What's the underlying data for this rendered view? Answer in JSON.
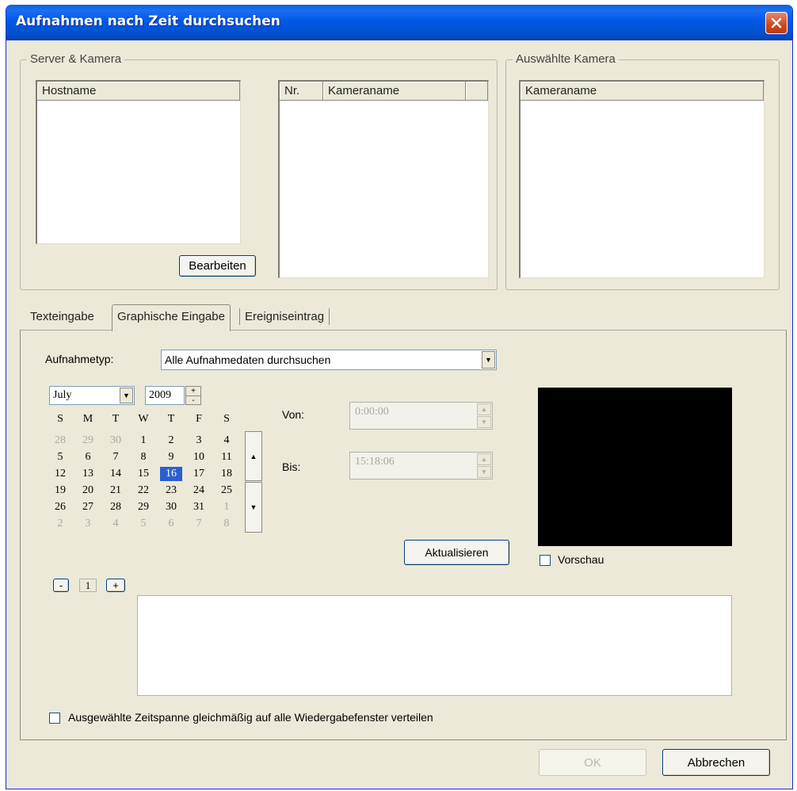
{
  "window": {
    "title": "Aufnahmen nach Zeit durchsuchen"
  },
  "server_group": {
    "label": "Server & Kamera",
    "host_header": "Hostname",
    "cam_headers": [
      "Nr.",
      "Kameraname"
    ],
    "edit_button": "Bearbeiten"
  },
  "selected_group": {
    "label": "Auswählte Kamera",
    "header": "Kameraname"
  },
  "tabs": [
    {
      "label": "Texteingabe",
      "active": false
    },
    {
      "label": "Graphische Eingabe",
      "active": true
    },
    {
      "label": "Ereigniseintrag",
      "active": false
    }
  ],
  "recording_type": {
    "label": "Aufnahmetyp:",
    "value": "Alle Aufnahmedaten durchsuchen"
  },
  "calendar": {
    "month": "July",
    "year": "2009",
    "weekdays": [
      "S",
      "M",
      "T",
      "W",
      "T",
      "F",
      "S"
    ],
    "weeks": [
      [
        "28",
        "29",
        "30",
        "1",
        "2",
        "3",
        "4"
      ],
      [
        "5",
        "6",
        "7",
        "8",
        "9",
        "10",
        "11"
      ],
      [
        "12",
        "13",
        "14",
        "15",
        "16",
        "17",
        "18"
      ],
      [
        "19",
        "20",
        "21",
        "22",
        "23",
        "24",
        "25"
      ],
      [
        "26",
        "27",
        "28",
        "29",
        "30",
        "31",
        "1"
      ],
      [
        "2",
        "3",
        "4",
        "5",
        "6",
        "7",
        "8"
      ]
    ],
    "selected_day": "16"
  },
  "time": {
    "from_label": "Von:",
    "from_value": "0:00:00",
    "to_label": "Bis:",
    "to_value": "15:18:06"
  },
  "refresh_button": "Aktualisieren",
  "preview": {
    "label": "Vorschau",
    "checked": false
  },
  "page_control": {
    "minus": "-",
    "value": "1",
    "plus": "+"
  },
  "distribute": {
    "label": "Ausgewählte Zeitspanne gleichmäßig auf alle Wiedergabefenster verteilen",
    "checked": false
  },
  "footer": {
    "ok": "OK",
    "cancel": "Abbrechen"
  }
}
